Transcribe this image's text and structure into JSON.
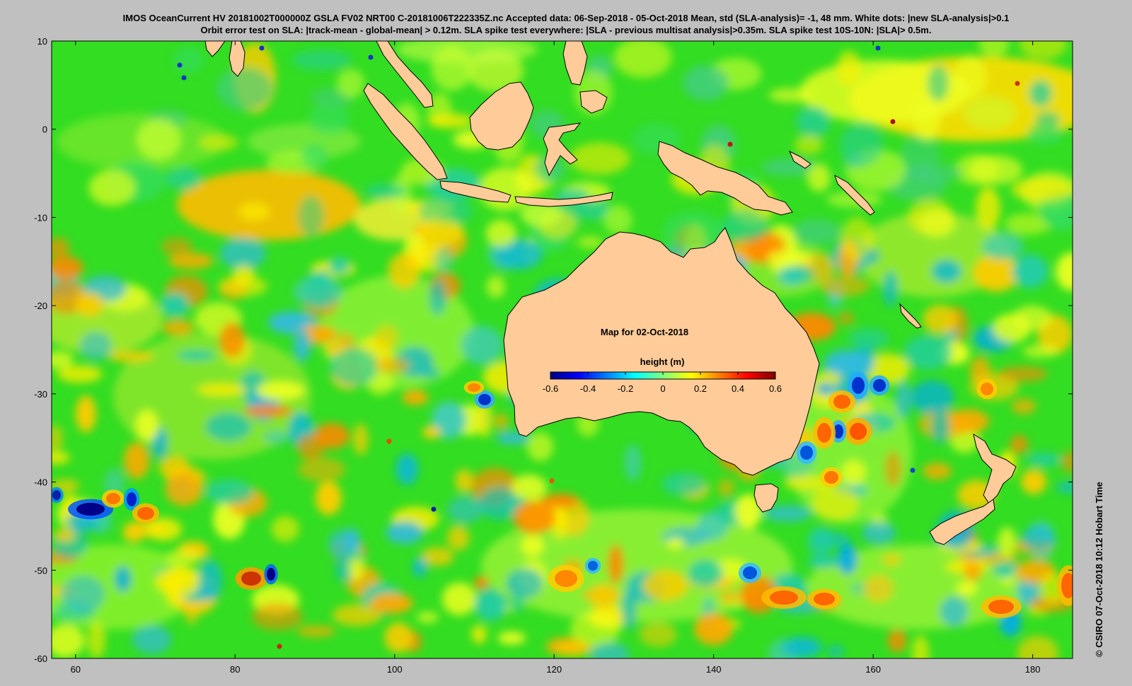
{
  "header": {
    "line1": "IMOS OceanCurrent HV 20181002T000000Z GSLA FV02 NRT00 C-20181006T222335Z.nc  Accepted data: 06-Sep-2018 - 05-Oct-2018 Mean, std (SLA-analysis)= -1, 48 mm. White dots: |new SLA-analysis|>0.1",
    "line2": "Orbit error test on SLA: |track-mean  - global-mean| > 0.12m.  SLA spike test everywhere: |SLA - previous multisat analysis|>0.35m. SLA spike test 10S-10N: |SLA|> 0.5m."
  },
  "map": {
    "title": "Map for 02-Oct-2018",
    "lon_range": [
      57,
      185
    ],
    "lat_range": [
      -60,
      10
    ],
    "x_ticks": [
      "60",
      "80",
      "100",
      "120",
      "140",
      "160",
      "180"
    ],
    "y_ticks": [
      "10",
      "0",
      "-10",
      "-20",
      "-30",
      "-40",
      "-50",
      "-60"
    ],
    "land_color": "#ffcc99",
    "colorbar": {
      "label": "height (m)",
      "ticks": [
        "-0.6",
        "-0.4",
        "-0.2",
        "0",
        "0.2",
        "0.4",
        "0.6"
      ],
      "colors": [
        "#00007f",
        "#0000ff",
        "#007fff",
        "#00ffff",
        "#7fff7f",
        "#ffff00",
        "#ff7f00",
        "#ff0000",
        "#7f0000"
      ]
    }
  },
  "footer": {
    "credit": "©  CSIRO 07-Oct-2018 10:12 Hobart Time"
  }
}
